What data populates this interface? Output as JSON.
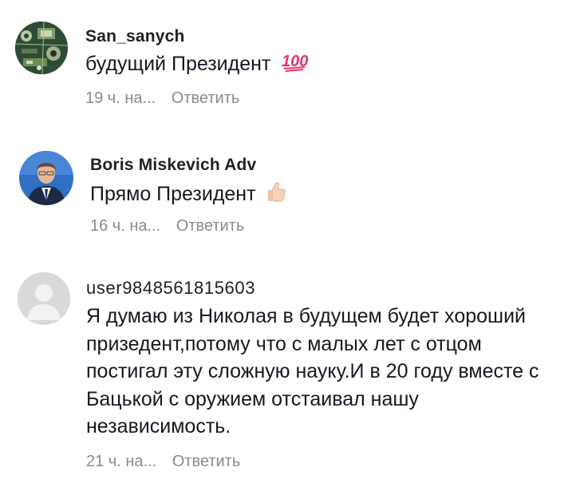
{
  "comments": [
    {
      "username": "San_sanych",
      "text": "будущий Президент",
      "emoji": "hundred-points-icon",
      "time": "19 ч. на...",
      "reply_label": "Ответить"
    },
    {
      "username": "Boris Miskevich Adv",
      "text": "Прямо Президент",
      "emoji": "thumbs-up-icon",
      "time": "16 ч. на...",
      "reply_label": "Ответить"
    },
    {
      "username": "user9848561815603",
      "text_lines": [
        "Я думаю из Николая в будущем будет хороший",
        "призедент,потому что с малых лет с отцом",
        "постигал эту сложную науку.И в 20 году вместе с",
        "Бацькой с оружием отстаивал нашу",
        "независимость."
      ],
      "time": "21 ч. на...",
      "reply_label": "Ответить"
    }
  ],
  "colors": {
    "text": "#161823",
    "meta": "#8a8b91",
    "emoji_red": "#e8336a",
    "default_avatar_bg": "#d9d9db"
  }
}
